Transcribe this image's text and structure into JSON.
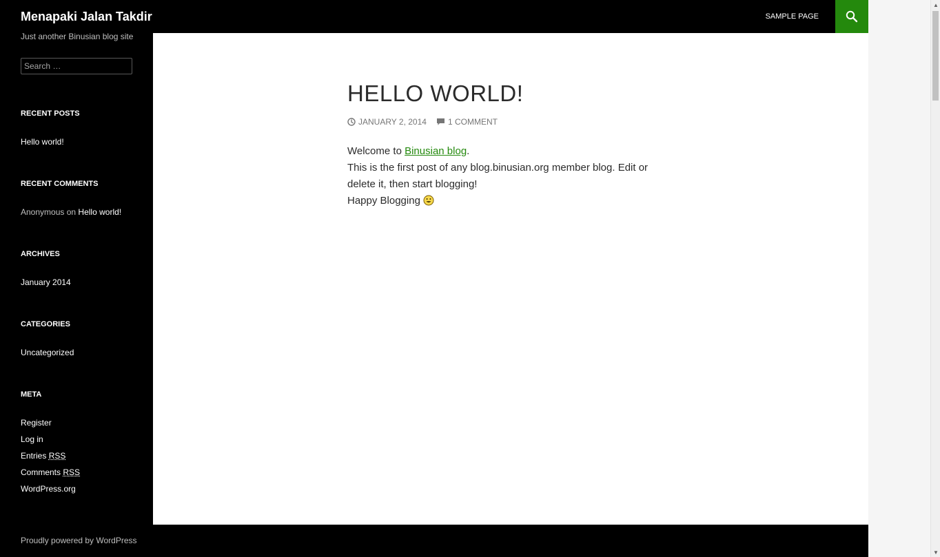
{
  "header": {
    "site_title": "Menapaki Jalan Takdir",
    "nav_items": [
      {
        "label": "SAMPLE PAGE"
      }
    ],
    "search_icon": "search-icon",
    "accent_color": "#24890d"
  },
  "sidebar": {
    "description": "Just another Binusian blog site",
    "search_placeholder": "Search …",
    "widgets": {
      "recent_posts": {
        "title": "RECENT POSTS",
        "items": [
          "Hello world!"
        ]
      },
      "recent_comments": {
        "title": "RECENT COMMENTS",
        "author": "Anonymous",
        "on": "on",
        "post": "Hello world!"
      },
      "archives": {
        "title": "ARCHIVES",
        "items": [
          "January 2014"
        ]
      },
      "categories": {
        "title": "CATEGORIES",
        "items": [
          "Uncategorized"
        ]
      },
      "meta": {
        "title": "META",
        "register": "Register",
        "login": "Log in",
        "entries": "Entries",
        "comments": "Comments",
        "rss": "RSS",
        "wordpress": "WordPress.org"
      }
    }
  },
  "post": {
    "title": "HELLO WORLD!",
    "date": "JANUARY 2, 2014",
    "comments": "1 COMMENT",
    "body": {
      "welcome_prefix": "Welcome to ",
      "welcome_link": "Binusian blog",
      "welcome_suffix": ".",
      "line2": "This is the first post of any blog.binusian.org member blog. Edit or delete it, then start blogging!",
      "line3": "Happy Blogging "
    }
  },
  "footer": {
    "credit": "Proudly powered by WordPress"
  }
}
